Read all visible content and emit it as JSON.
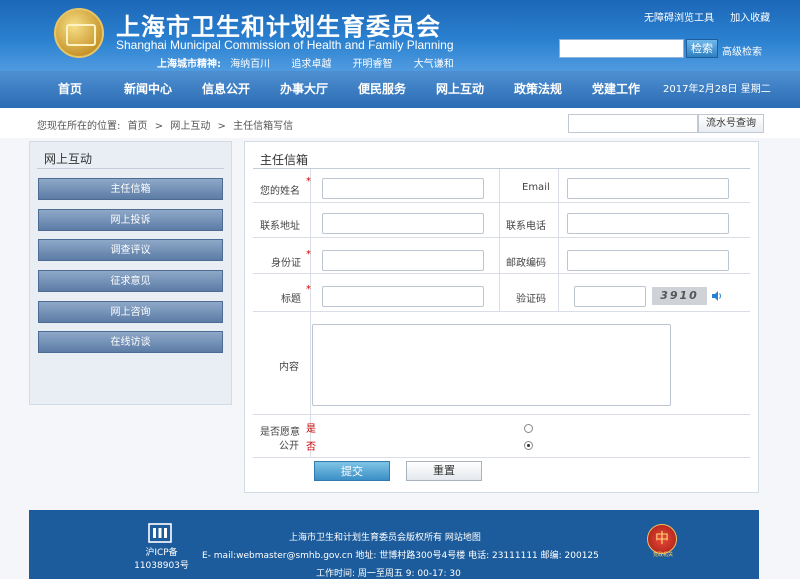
{
  "header": {
    "title_cn": "上海市卫生和计划生育委员会",
    "title_en": "Shanghai Municipal Commission of Health and Family Planning",
    "spirit_label": "上海城市精神:",
    "spirit_items": [
      "海纳百川",
      "追求卓越",
      "开明睿智",
      "大气谦和"
    ],
    "links": [
      "无障碍浏览工具",
      "加入收藏"
    ],
    "search_button": "检索",
    "advanced_search": "高级检索"
  },
  "nav": {
    "items": [
      "首页",
      "新闻中心",
      "信息公开",
      "办事大厅",
      "便民服务",
      "网上互动",
      "政策法规",
      "党建工作"
    ],
    "date": "2017年2月28日 星期二"
  },
  "breadcrumb": {
    "prefix": "您现在所在的位置:",
    "items": [
      "首页",
      "网上互动",
      "主任信箱写信"
    ],
    "separator": ">"
  },
  "serial_query": {
    "button": "流水号查询"
  },
  "sidebar": {
    "title": "网上互动",
    "items": [
      "主任信箱",
      "网上投诉",
      "调查评议",
      "征求意见",
      "网上咨询",
      "在线访谈"
    ]
  },
  "form": {
    "title": "主任信箱",
    "required_mark": "*",
    "name_label": "您的姓名",
    "email_label": "Email",
    "address_label": "联系地址",
    "phone_label": "联系电话",
    "id_label": "身份证",
    "zip_label": "邮政编码",
    "subject_label": "标题",
    "captcha_label": "验证码",
    "captcha_text": "3910",
    "speaker_icon": "speaker-icon",
    "content_label": "内容",
    "public_label_1": "是否愿意",
    "public_label_2": "公开",
    "option_yes": "是",
    "option_no": "否",
    "selected_option": "否",
    "submit": "提交",
    "reset": "重置"
  },
  "footer": {
    "copyright": "上海市卫生和计划生育委员会版权所有 网站地图",
    "contact": "E- mail:webmaster@smhb.gov.cn 地址: 世博村路300号4号楼 电话: 23111111 邮编: 200125",
    "hours": "工作时间: 周一至周五 9: 00-17: 30",
    "icp": "沪ICP备11038903号",
    "badge_text": "党政机关"
  },
  "colors": {
    "header_blue": "#2a80cf",
    "nav_blue": "#2b6db4",
    "footer_blue": "#1d5c9c",
    "required_red": "#cc0000"
  }
}
